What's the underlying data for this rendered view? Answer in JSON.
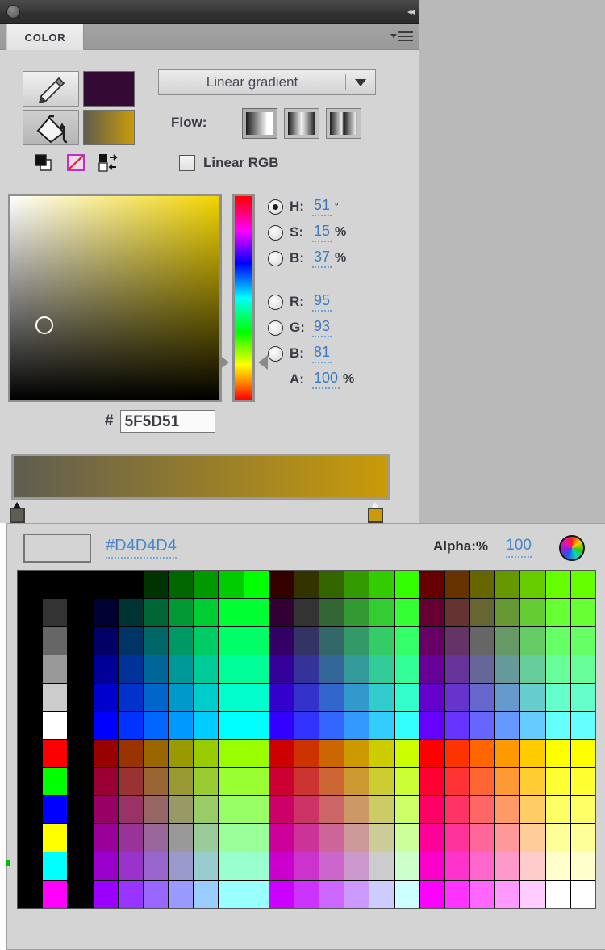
{
  "window": {
    "collapse_icon": "collapse-left-icon",
    "knob_icon": "window-knob-icon"
  },
  "tabs": [
    {
      "label": "COLOR",
      "active": true
    }
  ],
  "panel_menu": {
    "icon": "panel-menu-icon"
  },
  "tools": {
    "stroke_tool_icon": "eyedropper-pencil-icon",
    "fill_tool_icon": "paint-bucket-icon",
    "stroke_color": "#330A33",
    "fill_gradient_from": "#5F5D51",
    "fill_gradient_to": "#C99B09",
    "default_colors_icon": "default-colors-icon",
    "no_color_icon": "no-color-icon",
    "swap_colors_icon": "swap-colors-icon"
  },
  "gradient": {
    "type_label": "Linear gradient",
    "caret_icon": "chevron-down-icon",
    "flow_label": "Flow:",
    "flow_options": [
      {
        "name": "pad",
        "active": true
      },
      {
        "name": "reflect",
        "active": false
      },
      {
        "name": "repeat",
        "active": false
      }
    ],
    "linear_rgb_label": "Linear RGB",
    "linear_rgb_checked": false,
    "preview_from": "#5F5D51",
    "preview_to": "#C99B09",
    "stops": [
      {
        "position": 0,
        "color": "#5F5D51"
      },
      {
        "position": 100,
        "color": "#C99B09"
      }
    ]
  },
  "picker": {
    "sb_square_hue_color": "#F2D400",
    "marker_x_pct": 12,
    "marker_y_pct": 59
  },
  "channels": [
    {
      "key": "H",
      "label": "H:",
      "value": "51",
      "unit": "°",
      "selected": true
    },
    {
      "key": "S",
      "label": "S:",
      "value": "15",
      "unit": "%",
      "selected": false
    },
    {
      "key": "B",
      "label": "B:",
      "value": "37",
      "unit": "%",
      "selected": false
    },
    {
      "key": "R",
      "label": "R:",
      "value": "95",
      "unit": "",
      "selected": false
    },
    {
      "key": "G",
      "label": "G:",
      "value": "93",
      "unit": "",
      "selected": false
    },
    {
      "key": "B2",
      "label": "B:",
      "value": "81",
      "unit": "",
      "selected": false
    }
  ],
  "alpha": {
    "label": "A:",
    "value": "100",
    "unit": "%"
  },
  "hex": {
    "prefix": "#",
    "value": "5F5D51"
  },
  "swatches_panel": {
    "current_hex": "#D4D4D4",
    "alpha_label": "Alpha:%",
    "alpha_value": "100",
    "color_wheel_icon": "color-wheel-icon",
    "preview_color": "#D4D4D4"
  },
  "swatch_grid": {
    "columns": 23,
    "rows": 12,
    "colors": [
      [
        "#000000",
        "#000000",
        "#000000",
        "#000000",
        "#000000",
        "#003300",
        "#006600",
        "#009900",
        "#00CC00",
        "#00FF00",
        "#330000",
        "#333300",
        "#336600",
        "#339900",
        "#33CC00",
        "#33FF00",
        "#660000",
        "#663300",
        "#666600",
        "#669900",
        "#66CC00",
        "#66FF00",
        "#66FF00"
      ],
      [
        "#000000",
        "#333333",
        "#000000",
        "#000033",
        "#003333",
        "#006633",
        "#009933",
        "#00CC33",
        "#00FF33",
        "#00FF33",
        "#330033",
        "#333333",
        "#336633",
        "#339933",
        "#33CC33",
        "#33FF33",
        "#660033",
        "#663333",
        "#666633",
        "#669933",
        "#66CC33",
        "#66FF33",
        "#66FF33"
      ],
      [
        "#000000",
        "#666666",
        "#000000",
        "#000066",
        "#003366",
        "#006666",
        "#009966",
        "#00CC66",
        "#00FF66",
        "#00FF66",
        "#330066",
        "#333366",
        "#336666",
        "#339966",
        "#33CC66",
        "#33FF66",
        "#660066",
        "#663366",
        "#666666",
        "#669966",
        "#66CC66",
        "#66FF66",
        "#66FF66"
      ],
      [
        "#000000",
        "#999999",
        "#000000",
        "#000099",
        "#003399",
        "#006699",
        "#009999",
        "#00CC99",
        "#00FF99",
        "#00FF99",
        "#330099",
        "#333399",
        "#336699",
        "#339999",
        "#33CC99",
        "#33FF99",
        "#660099",
        "#663399",
        "#666699",
        "#669999",
        "#66CC99",
        "#66FF99",
        "#66FF99"
      ],
      [
        "#000000",
        "#CCCCCC",
        "#000000",
        "#0000CC",
        "#0033CC",
        "#0066CC",
        "#0099CC",
        "#00CCCC",
        "#00FFCC",
        "#00FFCC",
        "#3300CC",
        "#3333CC",
        "#3366CC",
        "#3399CC",
        "#33CCCC",
        "#33FFCC",
        "#6600CC",
        "#6633CC",
        "#6666CC",
        "#6699CC",
        "#66CCCC",
        "#66FFCC",
        "#66FFCC"
      ],
      [
        "#000000",
        "#FFFFFF",
        "#000000",
        "#0000FF",
        "#0033FF",
        "#0066FF",
        "#0099FF",
        "#00CCFF",
        "#00FFFF",
        "#00FFFF",
        "#3300FF",
        "#3333FF",
        "#3366FF",
        "#3399FF",
        "#33CCFF",
        "#33FFFF",
        "#6600FF",
        "#6633FF",
        "#6666FF",
        "#6699FF",
        "#66CCFF",
        "#66FFFF",
        "#66FFFF"
      ],
      [
        "#000000",
        "#FF0000",
        "#000000",
        "#990000",
        "#993300",
        "#996600",
        "#999900",
        "#99CC00",
        "#99FF00",
        "#99FF00",
        "#CC0000",
        "#CC3300",
        "#CC6600",
        "#CC9900",
        "#CCCC00",
        "#CCFF00",
        "#FF0000",
        "#FF3300",
        "#FF6600",
        "#FF9900",
        "#FFCC00",
        "#FFFF00",
        "#FFFF00"
      ],
      [
        "#000000",
        "#00FF00",
        "#000000",
        "#990033",
        "#993333",
        "#996633",
        "#999933",
        "#99CC33",
        "#99FF33",
        "#99FF33",
        "#CC0033",
        "#CC3333",
        "#CC6633",
        "#CC9933",
        "#CCCC33",
        "#CCFF33",
        "#FF0033",
        "#FF3333",
        "#FF6633",
        "#FF9933",
        "#FFCC33",
        "#FFFF33",
        "#FFFF33"
      ],
      [
        "#000000",
        "#0000FF",
        "#000000",
        "#990066",
        "#993366",
        "#996666",
        "#999966",
        "#99CC66",
        "#99FF66",
        "#99FF66",
        "#CC0066",
        "#CC3366",
        "#CC6666",
        "#CC9966",
        "#CCCC66",
        "#CCFF66",
        "#FF0066",
        "#FF3366",
        "#FF6666",
        "#FF9966",
        "#FFCC66",
        "#FFFF66",
        "#FFFF66"
      ],
      [
        "#000000",
        "#FFFF00",
        "#000000",
        "#990099",
        "#993399",
        "#996699",
        "#999999",
        "#99CC99",
        "#99FF99",
        "#99FF99",
        "#CC0099",
        "#CC3399",
        "#CC6699",
        "#CC9999",
        "#CCCC99",
        "#CCFF99",
        "#FF0099",
        "#FF3399",
        "#FF6699",
        "#FF9999",
        "#FFCC99",
        "#FFFF99",
        "#FFFF99"
      ],
      [
        "#000000",
        "#00FFFF",
        "#000000",
        "#9900CC",
        "#9933CC",
        "#9966CC",
        "#9999CC",
        "#99CCCC",
        "#99FFCC",
        "#99FFCC",
        "#CC00CC",
        "#CC33CC",
        "#CC66CC",
        "#CC99CC",
        "#CCCCCC",
        "#CCFFCC",
        "#FF00CC",
        "#FF33CC",
        "#FF66CC",
        "#FF99CC",
        "#FFCCCC",
        "#FFFFCC",
        "#FFFFCC"
      ],
      [
        "#000000",
        "#FF00FF",
        "#000000",
        "#9900FF",
        "#9933FF",
        "#9966FF",
        "#9999FF",
        "#99CCFF",
        "#99FFFF",
        "#99FFFF",
        "#CC00FF",
        "#CC33FF",
        "#CC66FF",
        "#CC99FF",
        "#CCCCFF",
        "#CCFFFF",
        "#FF00FF",
        "#FF33FF",
        "#FF66FF",
        "#FF99FF",
        "#FFCCFF",
        "#FFFFFF",
        "#FFFFFF"
      ]
    ]
  }
}
